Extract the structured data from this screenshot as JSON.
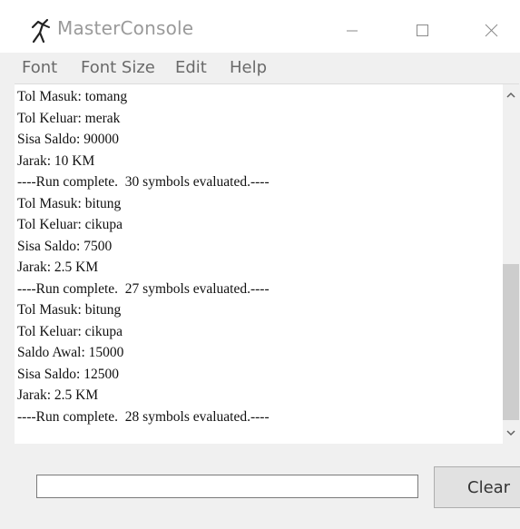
{
  "window": {
    "title": "MasterConsole",
    "icon": "app-stick-figure-icon"
  },
  "menu": {
    "items": [
      "Font",
      "Font Size",
      "Edit",
      "Help"
    ]
  },
  "console": {
    "lines": [
      "Tol Masuk: tomang",
      "Tol Keluar: merak",
      "Sisa Saldo: 90000",
      "Jarak: 10 KM",
      "----Run complete.  30 symbols evaluated.----",
      "Tol Masuk: bitung",
      "Tol Keluar: cikupa",
      "Sisa Saldo: 7500",
      "Jarak: 2.5 KM",
      "----Run complete.  27 symbols evaluated.----",
      "Tol Masuk: bitung",
      "Tol Keluar: cikupa",
      "Saldo Awal: 15000",
      "Sisa Saldo: 12500",
      "Jarak: 2.5 KM",
      "----Run complete.  28 symbols evaluated.----"
    ]
  },
  "input": {
    "value": ""
  },
  "buttons": {
    "clear_label": "Clear"
  },
  "colors": {
    "title_text": "#9a9a9a",
    "menu_text": "#6a6a6a",
    "console_bg": "#ffffff",
    "window_bg": "#f0f0f0"
  }
}
